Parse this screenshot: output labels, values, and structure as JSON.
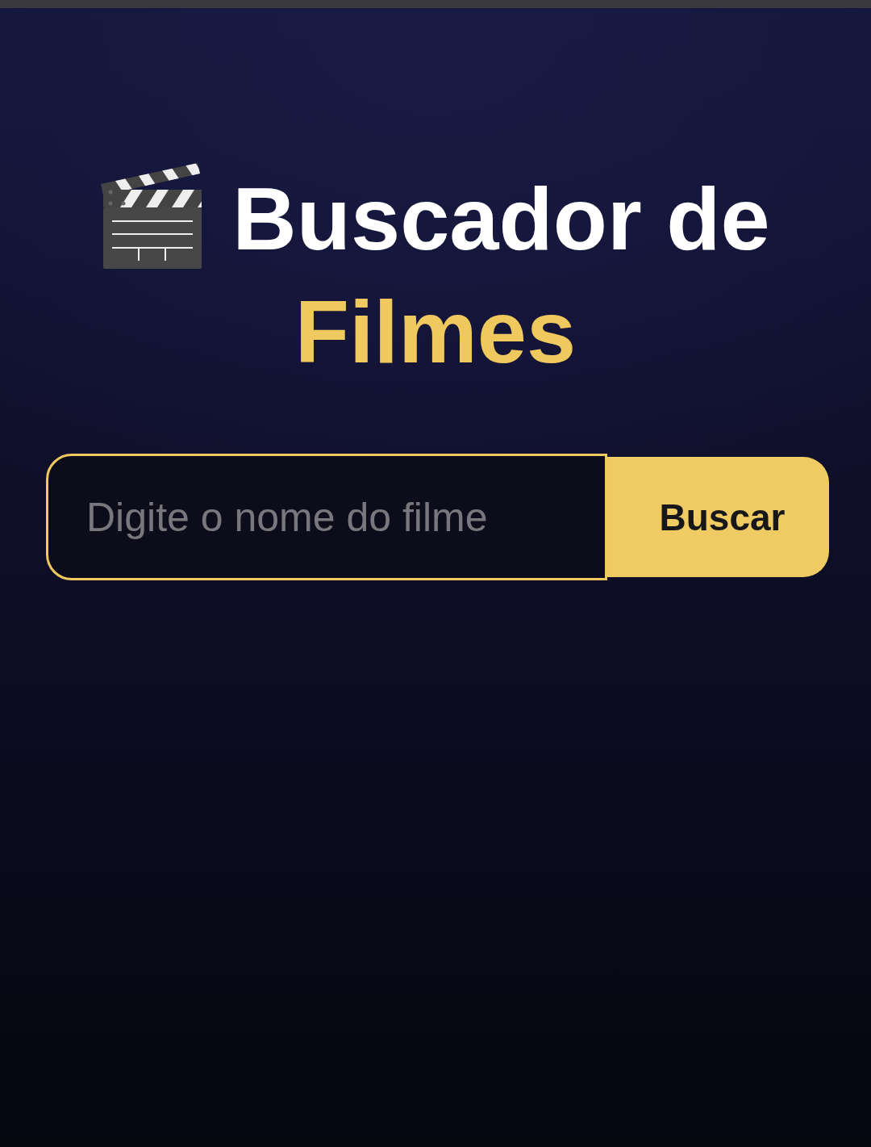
{
  "title": {
    "text": "Buscador de",
    "highlight": "Filmes"
  },
  "search": {
    "placeholder": "Digite o nome do filme",
    "button": "Buscar"
  }
}
